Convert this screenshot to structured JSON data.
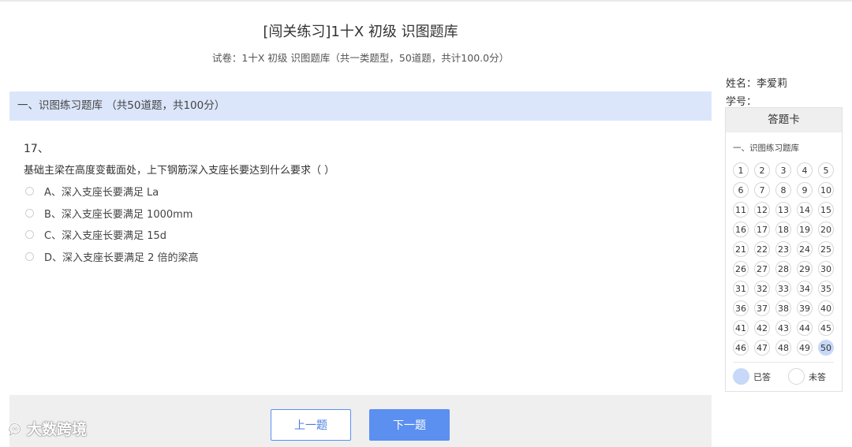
{
  "page": {
    "title": "[闯关练习]1十X 初级 识图题库",
    "subtitle": "试卷：1十X 初级 识图题库（共一类题型，50道题，共计100.0分）"
  },
  "section": {
    "title": "一、识图练习题库 （共50道题，共100分）"
  },
  "question": {
    "number": "17、",
    "text": "基础主梁在高度变截面处，上下钢筋深入支座长要达到什么要求（ ）",
    "options": [
      "A、深入支座长要满足 La",
      "B、深入支座长要满足 1000mm",
      "C、深入支座长要满足 15d",
      "D、深入支座长要满足 2 倍的梁高"
    ]
  },
  "navigation": {
    "prev_label": "上一题",
    "next_label": "下一题"
  },
  "user": {
    "name_label": "姓名：李爱莉",
    "id_label": "学号："
  },
  "answer_card": {
    "title": "答题卡",
    "section_label": "一、识图练习题库",
    "numbers": [
      "1",
      "2",
      "3",
      "4",
      "5",
      "6",
      "7",
      "8",
      "9",
      "10",
      "11",
      "12",
      "13",
      "14",
      "15",
      "16",
      "17",
      "18",
      "19",
      "20",
      "21",
      "22",
      "23",
      "24",
      "25",
      "26",
      "27",
      "28",
      "29",
      "30",
      "31",
      "32",
      "33",
      "34",
      "35",
      "36",
      "37",
      "38",
      "39",
      "40",
      "41",
      "42",
      "43",
      "44",
      "45",
      "46",
      "47",
      "48",
      "49",
      "50"
    ],
    "answered": [
      "50"
    ],
    "legend_answered": "已答",
    "legend_unanswered": "未答"
  },
  "watermark": {
    "text": "大数跨境",
    "icon": "chat-bubble-logo-icon"
  },
  "colors": {
    "accent": "#5b8ff0",
    "section_bg": "#dbe6fb",
    "answered": "#c7d8f8"
  }
}
